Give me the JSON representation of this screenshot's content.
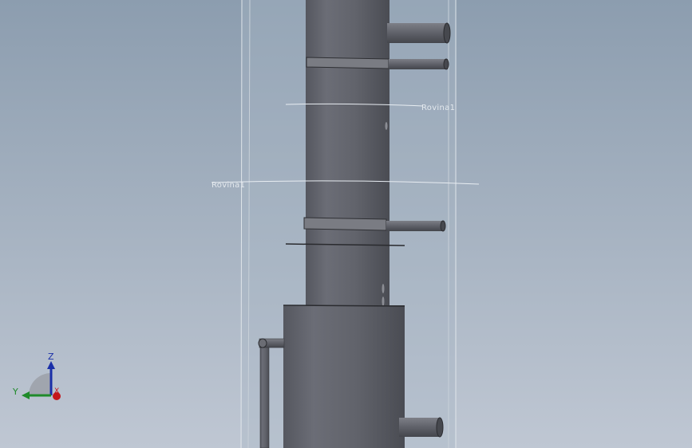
{
  "viewport": {
    "background_top": "#8c9daf",
    "background_bottom": "#bfc7d3",
    "part_color": "#5f6169",
    "plane_labels": [
      "Rovina1",
      "Rovina1"
    ]
  },
  "triad": {
    "z_label": "Z",
    "y_label": "Y",
    "x_label": "X",
    "z_color": "#1a2fa8",
    "y_color": "#1f8a2a",
    "x_color": "#c4161c"
  }
}
